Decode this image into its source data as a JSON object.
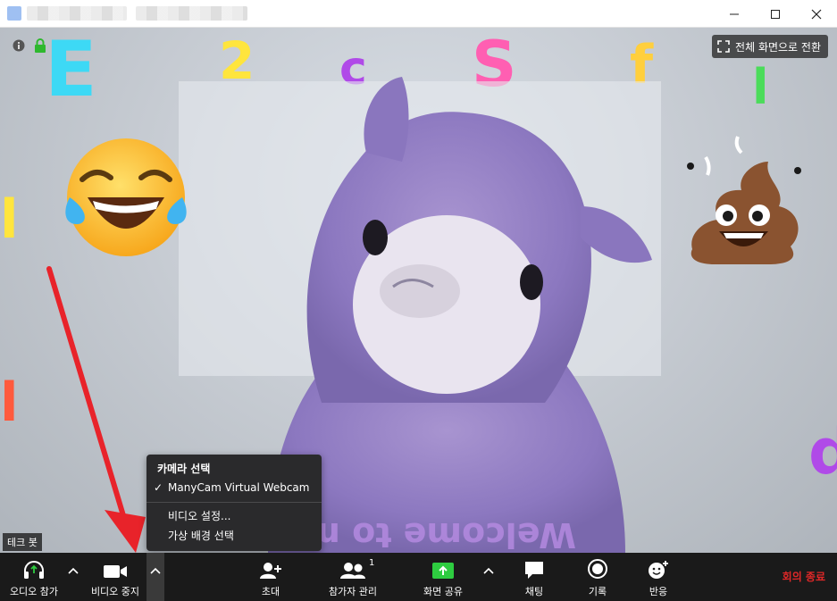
{
  "window": {
    "title": "",
    "controls": [
      "minimize",
      "maximize",
      "close"
    ]
  },
  "stage": {
    "fullscreen_label": "전체 화면으로 전환",
    "participant_name": "테크 봇",
    "top_icons": [
      "info-icon",
      "lock-icon"
    ]
  },
  "camera_menu": {
    "header": "카메라 선택",
    "camera_selected": "ManyCam Virtual Webcam",
    "video_settings": "비디오 설정...",
    "virtual_background": "가상 배경 선택"
  },
  "toolbar": {
    "audio_label": "오디오 참가",
    "video_label": "비디오 중지",
    "invite_label": "초대",
    "participants_label": "참가자 관리",
    "participants_count": "1",
    "share_label": "화면 공유",
    "chat_label": "채팅",
    "record_label": "기록",
    "reactions_label": "반응",
    "end_label": "회의 종료"
  },
  "colors": {
    "toolbar_bg": "#1a1a1a",
    "share_green": "#2ecc40",
    "end_red": "#e02828",
    "annotation_arrow": "#e8232a"
  }
}
